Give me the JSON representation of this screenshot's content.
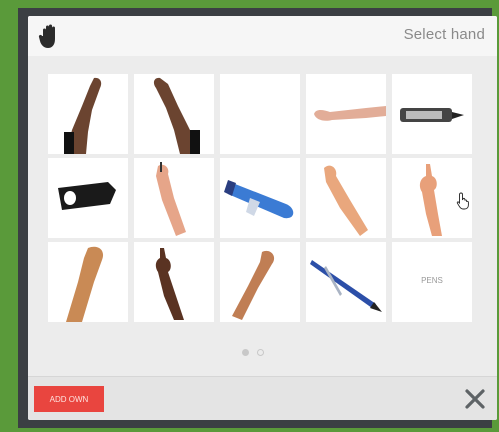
{
  "header": {
    "title": "Select hand",
    "icon": "hand-stop-icon"
  },
  "grid": {
    "tiles": [
      {
        "name": "hand-dark-raised-left",
        "label": ""
      },
      {
        "name": "hand-dark-raised-right",
        "label": ""
      },
      {
        "name": "hand-empty",
        "label": ""
      },
      {
        "name": "hand-light-horizontal",
        "label": ""
      },
      {
        "name": "hand-marker-gray",
        "label": ""
      },
      {
        "name": "hand-eraser-black",
        "label": ""
      },
      {
        "name": "hand-light-pen-up",
        "label": ""
      },
      {
        "name": "hand-marker-blue",
        "label": ""
      },
      {
        "name": "hand-light-pen-diagonal",
        "label": ""
      },
      {
        "name": "hand-light-pointing",
        "label": ""
      },
      {
        "name": "hand-tan-raised",
        "label": ""
      },
      {
        "name": "hand-dark-pointing",
        "label": ""
      },
      {
        "name": "hand-tan-pen",
        "label": ""
      },
      {
        "name": "hand-blue-pen",
        "label": ""
      },
      {
        "name": "hand-pens",
        "label": "PENS"
      }
    ]
  },
  "pager": {
    "pages": 2,
    "current": 1
  },
  "footer": {
    "add_own_label": "ADD OWN",
    "close_icon": "close-x-icon"
  },
  "colors": {
    "accent_red": "#e9453f",
    "panel_bg": "#ececec",
    "outer_green": "#5a9a3a",
    "title_gray": "#8a8a8a"
  }
}
